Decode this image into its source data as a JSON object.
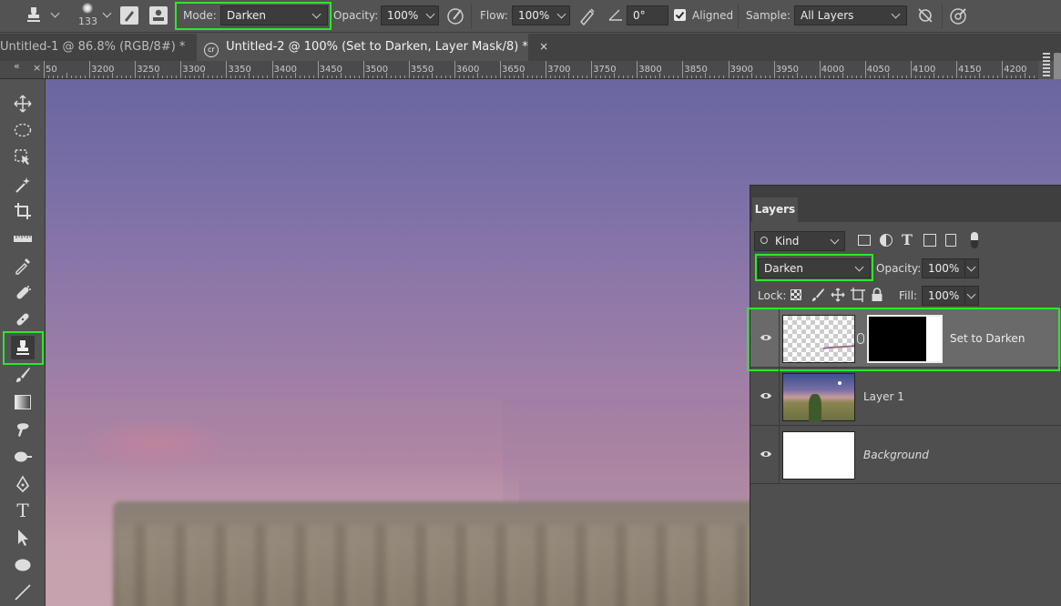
{
  "options_bar": {
    "brush_size": "133",
    "mode_label": "Mode:",
    "mode_value": "Darken",
    "opacity_label": "Opacity:",
    "opacity_value": "100%",
    "flow_label": "Flow:",
    "flow_value": "100%",
    "angle_value": "0°",
    "aligned_label": "Aligned",
    "aligned_checked": true,
    "sample_label": "Sample:",
    "sample_value": "All Layers"
  },
  "tabs": [
    {
      "label": "Untitled-1 @ 86.8% (RGB/8#) *",
      "active": false
    },
    {
      "label": "Untitled-2 @ 100% (Set to Darken, Layer Mask/8) *",
      "active": true
    }
  ],
  "tab_close": "×",
  "ruler": {
    "collapse": "«",
    "labels": [
      "50",
      "3200",
      "3250",
      "3300",
      "3350",
      "3400",
      "3450",
      "3500",
      "3550",
      "3600",
      "3650",
      "3700",
      "3750",
      "3800",
      "3850",
      "3900",
      "3950",
      "4000",
      "4050",
      "4100",
      "4150",
      "4200"
    ]
  },
  "toolbar": {
    "tools": [
      "move-tool",
      "elliptical-marquee-tool",
      "object-selection-tool",
      "magic-wand-tool",
      "crop-tool",
      "ruler-tool",
      "eyedropper-tool",
      "spot-healing-tool",
      "healing-brush-tool",
      "clone-stamp-tool",
      "brush-tool",
      "gradient-tool",
      "smudge-tool",
      "dodge-tool",
      "pen-tool",
      "type-tool",
      "path-selection-tool",
      "ellipse-tool",
      "line-tool"
    ],
    "active": "clone-stamp-tool",
    "type_glyph": "T"
  },
  "layers_panel": {
    "tab_label": "Layers",
    "filter_value": "Kind",
    "filter_type_glyph": "T",
    "blend_mode": "Darken",
    "opacity_label": "Opacity:",
    "opacity_value": "100%",
    "lock_label": "Lock:",
    "fill_label": "Fill:",
    "fill_value": "100%",
    "layers": [
      {
        "name": "Set to Darken",
        "selected": true,
        "italic": false,
        "has_mask": true
      },
      {
        "name": "Layer 1",
        "selected": false,
        "italic": false,
        "has_mask": false
      },
      {
        "name": "Background",
        "selected": false,
        "italic": true,
        "has_mask": false
      }
    ]
  },
  "colors": {
    "highlight": "#2ee62e",
    "panel_bg": "#4f4f4f",
    "selected_row": "#6a6a6a"
  }
}
